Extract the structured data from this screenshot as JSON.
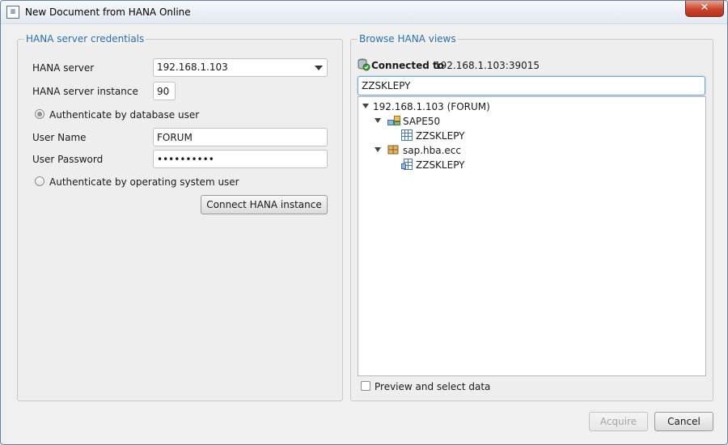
{
  "window": {
    "title": "New Document from HANA Online",
    "close_glyph": "✕"
  },
  "credentials": {
    "legend": "HANA server credentials",
    "server_label": "HANA server",
    "server_value": "192.168.1.103",
    "instance_label": "HANA server instance",
    "instance_value": "90",
    "auth_db_label": "Authenticate by database user",
    "username_label": "User Name",
    "username_value": "FORUM",
    "password_label": "User Password",
    "password_value": "••••••••••",
    "auth_os_label": "Authenticate by operating system user",
    "connect_button": "Connect HANA instance"
  },
  "browse": {
    "legend": "Browse HANA views",
    "connected_label": "Connected to",
    "connected_value": "192.168.1.103:39015",
    "search_value": "ZZSKLEPY",
    "tree": {
      "root": "192.168.1.103 (FORUM)",
      "schema1": "SAPE50",
      "schema1_child": "ZZSKLEPY",
      "package1": "sap.hba.ecc",
      "package1_child": "ZZSKLEPY"
    },
    "preview_label": "Preview and select data"
  },
  "footer": {
    "acquire_button": "Acquire",
    "cancel_button": "Cancel"
  },
  "icons": {
    "app": "sap-document-icon",
    "db_connected": "database-connected-icon",
    "schema": "schema-icon",
    "table": "table-icon",
    "package": "package-icon",
    "view": "view-icon"
  }
}
